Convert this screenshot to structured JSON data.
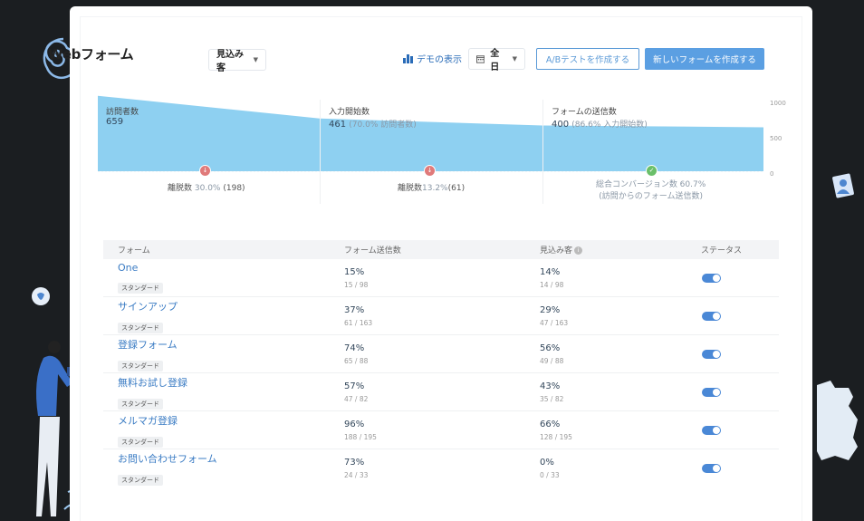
{
  "header": {
    "title": "Webフォーム",
    "type_filter": "見込み客",
    "demo_link": "デモの表示",
    "date_filter": "全日",
    "ab_test_button": "A/Bテストを作成する",
    "new_form_button": "新しいフォームを作成する"
  },
  "funnel": {
    "axis_ticks": [
      "1000",
      "500",
      "0"
    ],
    "axis_max": 1000,
    "stages": [
      {
        "label": "訪問者数",
        "value": "659",
        "sub": ""
      },
      {
        "label": "入力開始数",
        "value": "461",
        "sub": "(70.0% 訪問者数)"
      },
      {
        "label": "フォームの送信数",
        "value": "400",
        "sub": "(86.6% 入力開始数)"
      }
    ],
    "stage_values": [
      659,
      461,
      400
    ],
    "drops": [
      {
        "label": "離脱数",
        "pct": "30.0%",
        "count": "(198)"
      },
      {
        "label": "離脱数",
        "pct": "13.2%",
        "count": "(61)"
      }
    ],
    "conversion": {
      "line1": "総合コンバージョン数 60.7%",
      "line2": "(訪問からのフォーム送信数)"
    },
    "colors": {
      "area": "#8ed0f1",
      "drop": "#e07a7a",
      "success": "#6abf69"
    }
  },
  "table": {
    "headers": [
      "フォーム",
      "フォーム送信数",
      "見込み客",
      "ステータス"
    ],
    "rows": [
      {
        "name": "One",
        "tag": "スタンダード",
        "submit_pct": "15%",
        "submit_ratio": "15 / 98",
        "lead_pct": "14%",
        "lead_ratio": "14 / 98",
        "enabled": true
      },
      {
        "name": "サインアップ",
        "tag": "スタンダード",
        "submit_pct": "37%",
        "submit_ratio": "61 / 163",
        "lead_pct": "29%",
        "lead_ratio": "47 / 163",
        "enabled": true
      },
      {
        "name": "登録フォーム",
        "tag": "スタンダード",
        "submit_pct": "74%",
        "submit_ratio": "65 / 88",
        "lead_pct": "56%",
        "lead_ratio": "49 / 88",
        "enabled": true
      },
      {
        "name": "無料お試し登録",
        "tag": "スタンダード",
        "submit_pct": "57%",
        "submit_ratio": "47 / 82",
        "lead_pct": "43%",
        "lead_ratio": "35 / 82",
        "enabled": true
      },
      {
        "name": "メルマガ登録",
        "tag": "スタンダード",
        "submit_pct": "96%",
        "submit_ratio": "188 / 195",
        "lead_pct": "66%",
        "lead_ratio": "128 / 195",
        "enabled": true
      },
      {
        "name": "お問い合わせフォーム",
        "tag": "スタンダード",
        "submit_pct": "73%",
        "submit_ratio": "24 / 33",
        "lead_pct": "0%",
        "lead_ratio": "0 / 33",
        "enabled": true
      }
    ]
  }
}
